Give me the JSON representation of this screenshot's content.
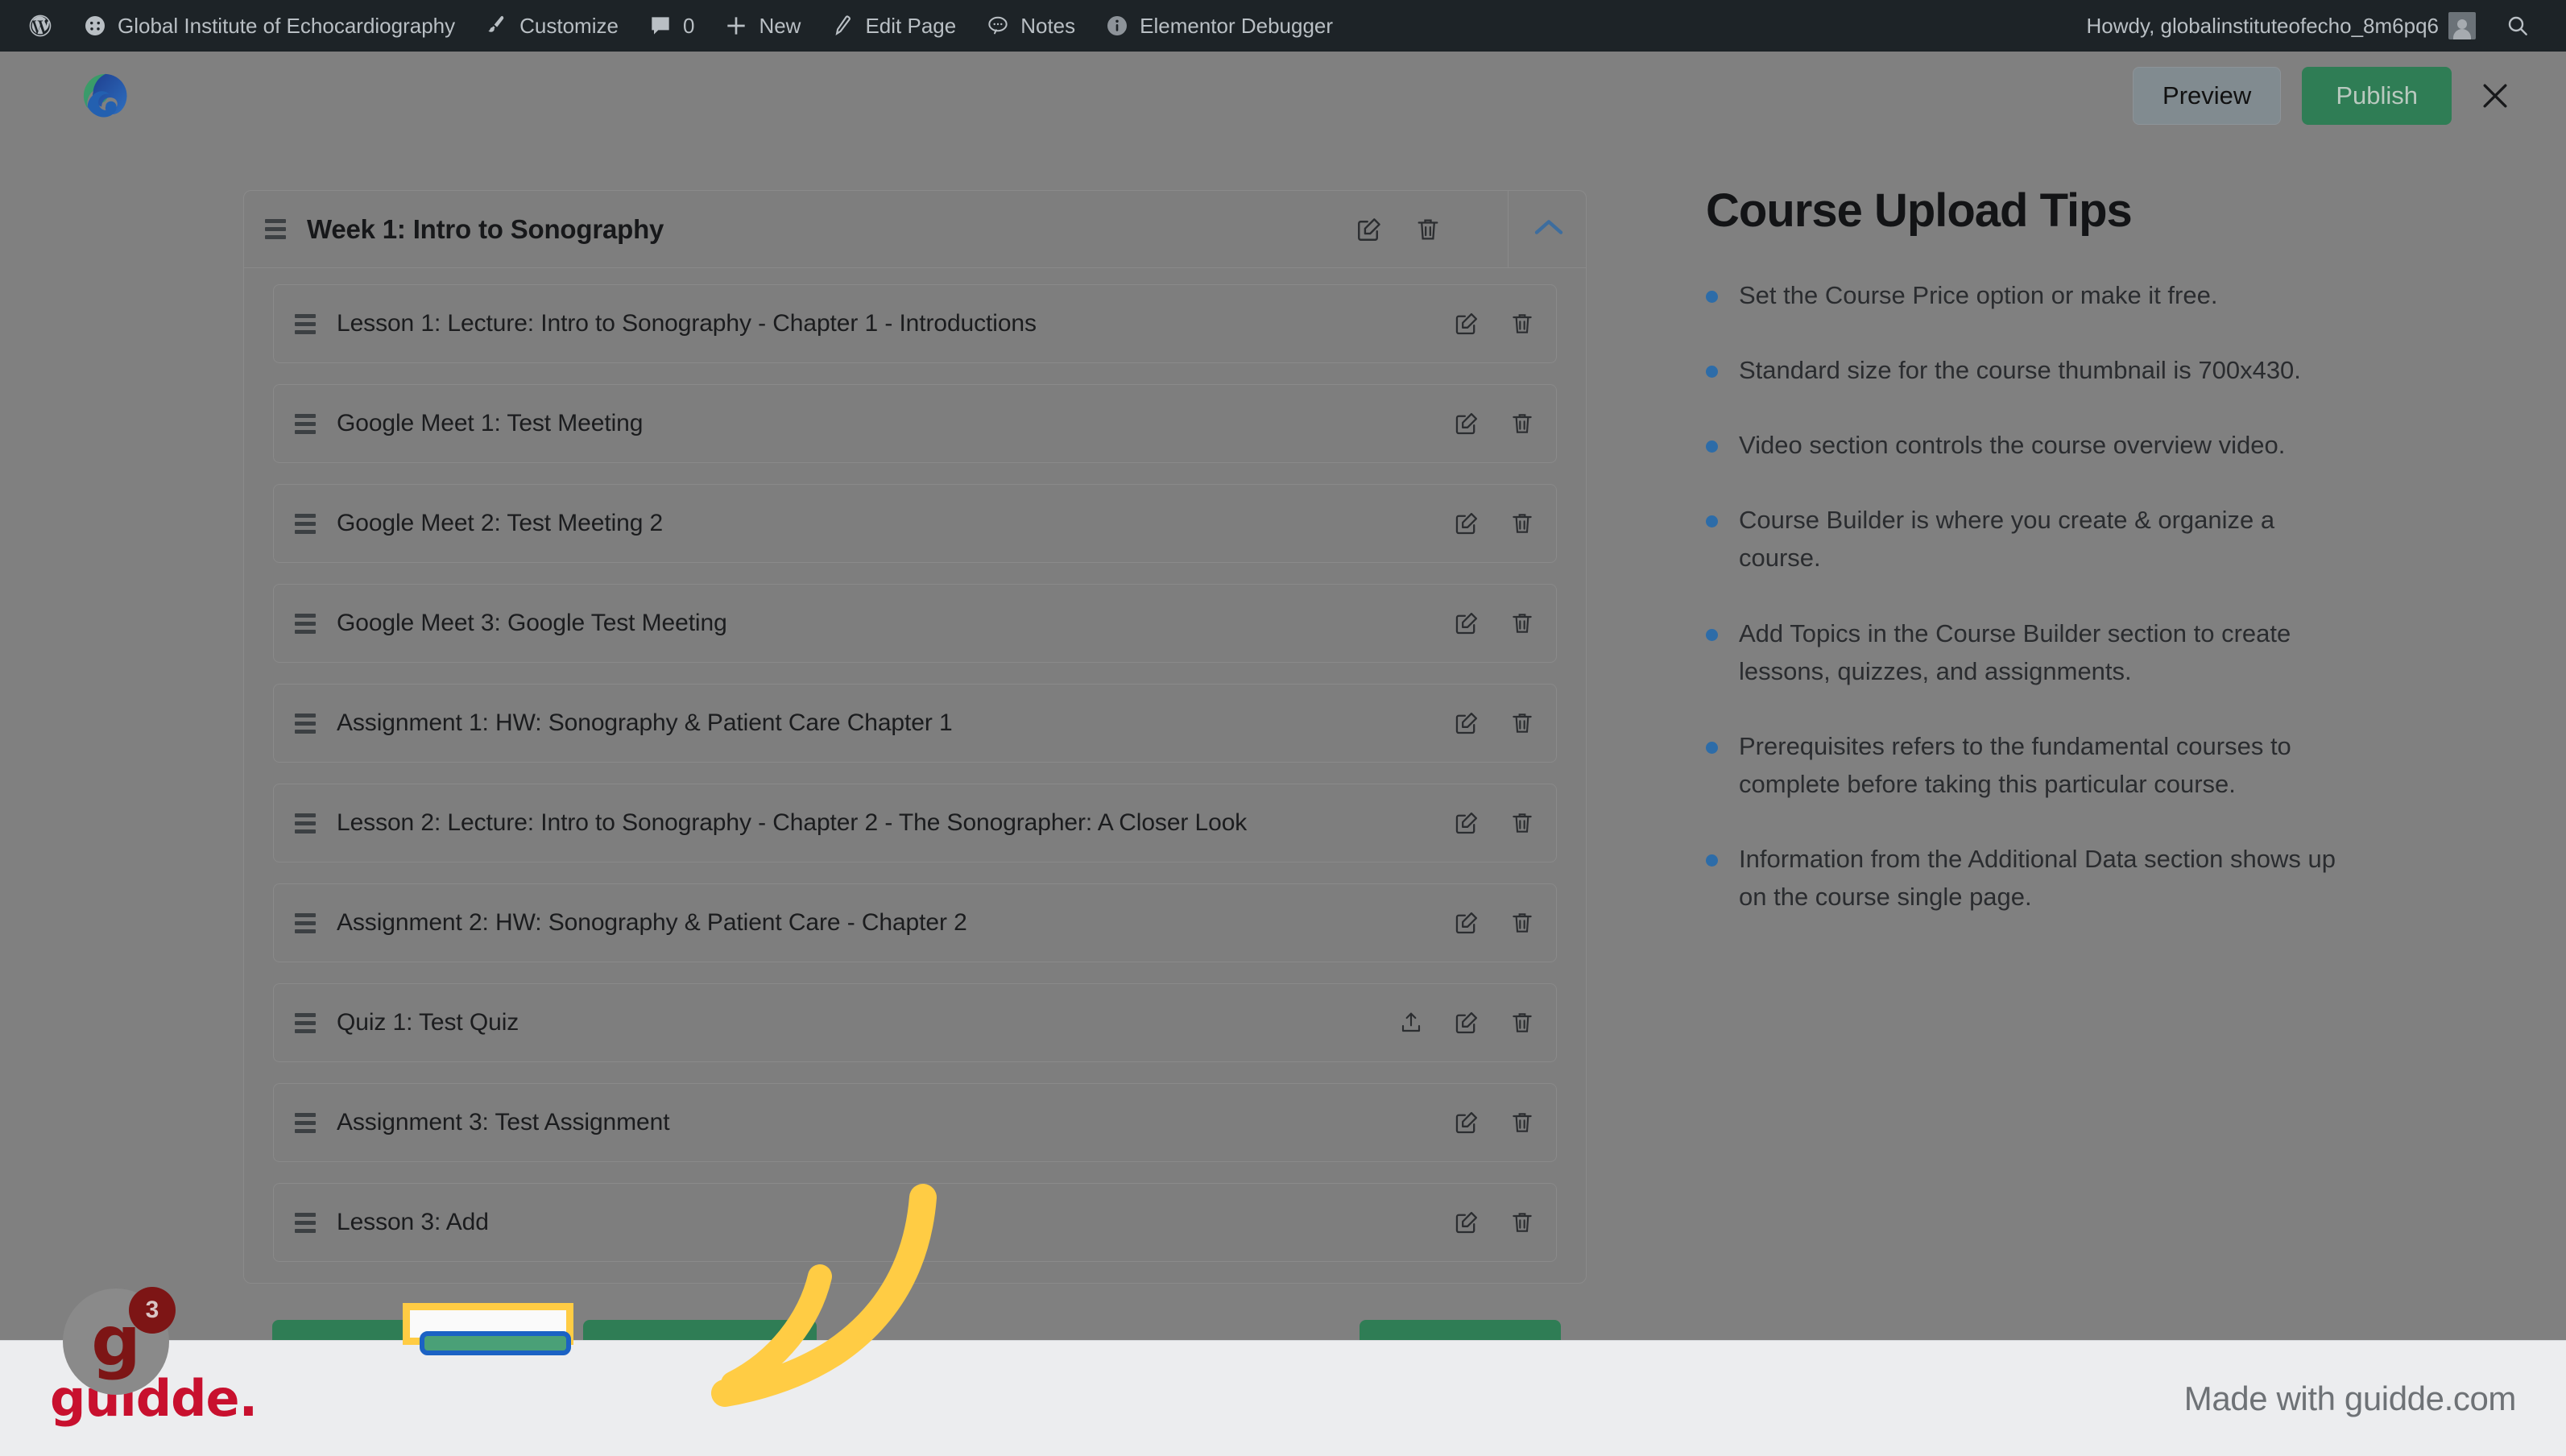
{
  "adminbar": {
    "items": [
      {
        "icon": "wordpress-logo-icon",
        "label": ""
      },
      {
        "icon": "site-icon",
        "label": "Global Institute of Echocardiography"
      },
      {
        "icon": "paintbrush-icon",
        "label": "Customize"
      },
      {
        "icon": "comment-icon",
        "label": "0"
      },
      {
        "icon": "plus-icon",
        "label": "New"
      },
      {
        "icon": "pencil-icon",
        "label": "Edit Page"
      },
      {
        "icon": "notes-icon",
        "label": "Notes"
      },
      {
        "icon": "info-icon",
        "label": "Elementor Debugger"
      }
    ],
    "howdy": "Howdy, globalinstituteofecho_8m6pq6"
  },
  "topbar": {
    "preview_label": "Preview",
    "publish_label": "Publish",
    "close_label": "×"
  },
  "builder": {
    "topic_title": "Week 1: Intro to Sonography",
    "rows": [
      {
        "title": "Lesson 1: Lecture: Intro to Sonography - Chapter 1 - Introductions",
        "export": false
      },
      {
        "title": "Google Meet 1: Test Meeting",
        "export": false
      },
      {
        "title": "Google Meet 2: Test Meeting 2",
        "export": false
      },
      {
        "title": "Google Meet 3: Google Test Meeting",
        "export": false
      },
      {
        "title": "Assignment 1: HW: Sonography & Patient Care Chapter 1",
        "export": false
      },
      {
        "title": "Lesson 2: Lecture: Intro to Sonography - Chapter 2 - The Sonographer: A Closer Look",
        "export": false
      },
      {
        "title": "Assignment 2: HW: Sonography & Patient Care - Chapter 2",
        "export": false
      },
      {
        "title": "Quiz 1: Test Quiz",
        "export": true
      },
      {
        "title": "Assignment 3: Test Assignment",
        "export": false
      },
      {
        "title": "Lesson 3: Add",
        "export": false
      }
    ]
  },
  "tips": {
    "title": "Course Upload Tips",
    "items": [
      "Set the Course Price option or make it free.",
      "Standard size for the course thumbnail is 700x430.",
      "Video section controls the course overview video.",
      "Course Builder is where you create & organize a course.",
      "Add Topics in the Course Builder section to create lessons, quizzes, and assignments.",
      "Prerequisites refers to the fundamental courses to complete before taking this particular course.",
      "Information from the Additional Data section shows up on the course single page."
    ]
  },
  "widget": {
    "letter": "g",
    "badge_count": "3"
  },
  "footer": {
    "logo": "guidde.",
    "made_with": "Made with guidde.com"
  },
  "colors": {
    "adminbar_bg": "#1d2327",
    "publish_green": "#2f7d55",
    "highlight_yellow": "#ffcc44",
    "annotation_blue": "#1b62c4",
    "bullet_blue": "#2d6ca8",
    "guidde_red": "#c8102e",
    "chevron_blue": "#3d6d9e"
  }
}
